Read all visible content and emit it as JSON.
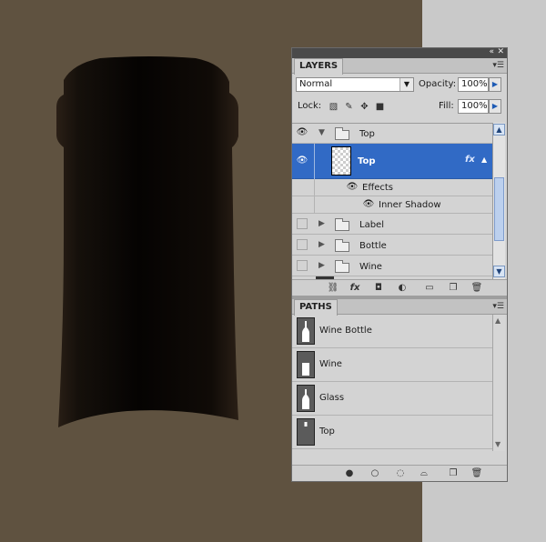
{
  "colors": {
    "canvas": "#5f5240",
    "cork_dark": "#0b0806",
    "cork_edge": "#2a1f16",
    "selection": "#316ac5"
  },
  "layers_panel": {
    "tab": "LAYERS",
    "blend_mode": "Normal",
    "opacity_label": "Opacity:",
    "opacity_value": "100%",
    "lock_label": "Lock:",
    "fill_label": "Fill:",
    "fill_value": "100%",
    "rows": [
      {
        "name": "Top",
        "kind": "group",
        "visible": true,
        "expanded": true
      },
      {
        "name": "Top",
        "kind": "layer",
        "visible": true,
        "selected": true,
        "fx": "fx"
      },
      {
        "name": "Effects",
        "kind": "effects"
      },
      {
        "name": "Inner Shadow",
        "kind": "effect"
      },
      {
        "name": "Label",
        "kind": "group",
        "visible": false
      },
      {
        "name": "Bottle",
        "kind": "group",
        "visible": false
      },
      {
        "name": "Wine",
        "kind": "group",
        "visible": false
      }
    ],
    "footer_icons": [
      "link-icon",
      "fx-icon",
      "mask-icon",
      "adjustment-icon",
      "folder-icon",
      "new-layer-icon",
      "trash-icon"
    ]
  },
  "paths_panel": {
    "tab": "PATHS",
    "rows": [
      {
        "name": "Wine Bottle"
      },
      {
        "name": "Wine"
      },
      {
        "name": "Glass"
      },
      {
        "name": "Top"
      }
    ],
    "footer_icons": [
      "fill-path-icon",
      "stroke-path-icon",
      "load-selection-icon",
      "make-path-icon",
      "new-path-icon",
      "trash-icon"
    ]
  }
}
